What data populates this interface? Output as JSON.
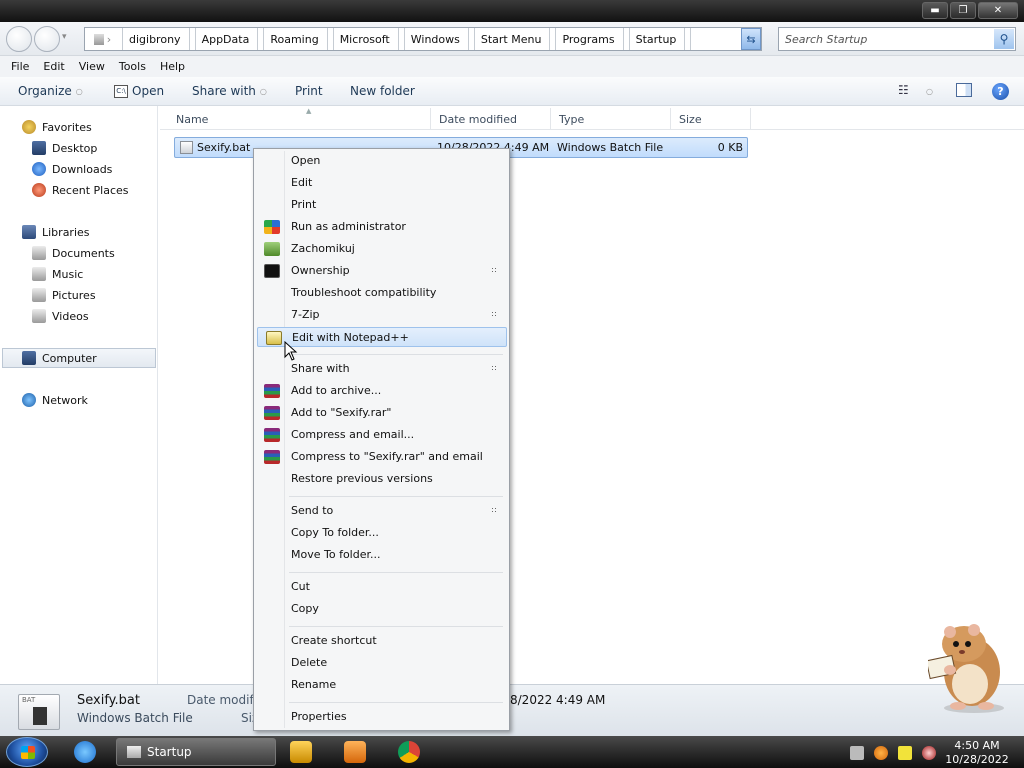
{
  "window": {
    "controls": {
      "minimize": "▬",
      "maximize": "❐",
      "close": "✕"
    }
  },
  "address": {
    "crumbs": [
      "digibrony",
      "AppData",
      "Roaming",
      "Microsoft",
      "Windows",
      "Start Menu",
      "Programs",
      "Startup"
    ],
    "search_placeholder": "Search Startup"
  },
  "menubar": [
    "File",
    "Edit",
    "View",
    "Tools",
    "Help"
  ],
  "commandbar": {
    "organize": "Organize",
    "open": "Open",
    "share_with": "Share with",
    "print": "Print",
    "new_folder": "New folder",
    "help": "?"
  },
  "navpane": {
    "favorites": "Favorites",
    "desktop": "Desktop",
    "downloads": "Downloads",
    "recent": "Recent Places",
    "libraries": "Libraries",
    "documents": "Documents",
    "music": "Music",
    "pictures": "Pictures",
    "videos": "Videos",
    "computer": "Computer",
    "network": "Network"
  },
  "columns": {
    "name": "Name",
    "date": "Date modified",
    "type": "Type",
    "size": "Size"
  },
  "file": {
    "name": "Sexify.bat",
    "date": "10/28/2022 4:49 AM",
    "type": "Windows Batch File",
    "size": "0 KB"
  },
  "details": {
    "name": "Sexify.bat",
    "type": "Windows Batch File",
    "date_label": "Date modifi",
    "size_label": "Siz",
    "date_value": "8/2022 4:49 AM",
    "icon_label": "BAT"
  },
  "context_menu": {
    "open": "Open",
    "edit": "Edit",
    "print": "Print",
    "run_as_admin": "Run as administrator",
    "zachomikuj": "Zachomikuj",
    "ownership": "Ownership",
    "troubleshoot": "Troubleshoot compatibility",
    "seven_zip": "7-Zip",
    "edit_notepad": "Edit with Notepad++",
    "share_with": "Share with",
    "add_archive": "Add to archive...",
    "add_rar": "Add to \"Sexify.rar\"",
    "compress_email": "Compress and email...",
    "compress_rar_email": "Compress to \"Sexify.rar\" and email",
    "restore": "Restore previous versions",
    "send_to": "Send to",
    "copy_to": "Copy To folder...",
    "move_to": "Move To folder...",
    "cut": "Cut",
    "copy": "Copy",
    "create_shortcut": "Create shortcut",
    "delete": "Delete",
    "rename": "Rename",
    "properties": "Properties"
  },
  "taskbar": {
    "task_label": "Startup",
    "time": "4:50 AM",
    "date": "10/28/2022"
  }
}
